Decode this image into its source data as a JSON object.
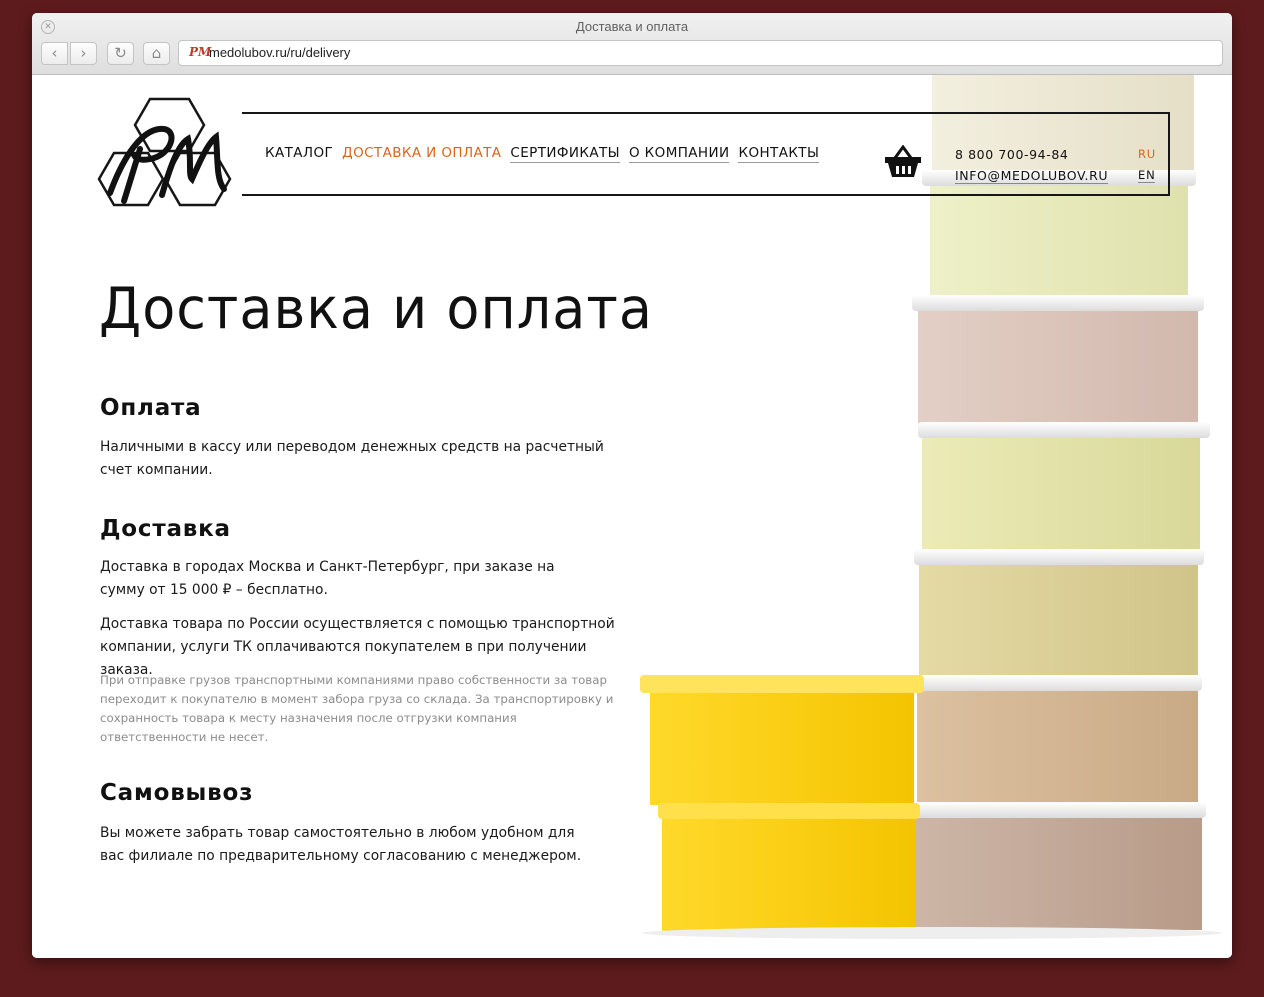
{
  "browser": {
    "window_title": "Доставка и оплата",
    "url": "medolubov.ru/ru/delivery",
    "favicon": "РМ"
  },
  "header": {
    "logo_text": "РМ",
    "menu": [
      {
        "label": "КАТАЛОГ"
      },
      {
        "label": "ДОСТАВКА И ОПЛАТА"
      },
      {
        "label": "СЕРТИФИКАТЫ"
      },
      {
        "label": "О КОМПАНИИ"
      },
      {
        "label": "КОНТАКТЫ"
      }
    ],
    "phone": "8 800 700-94-84",
    "email": "INFO@MEDOLUBOV.RU",
    "lang_ru": "RU",
    "lang_en": "EN"
  },
  "content": {
    "title": "Доставка и оплата",
    "payment": {
      "heading": "Оплата",
      "text": "Наличными в кассу или переводом денежных средств на расчетный счет компании."
    },
    "delivery": {
      "heading": "Доставка",
      "text1": "Доставка в городах Москва и Санкт-Петербург, при заказе на сумму от 15 000 ₽ – бесплатно.",
      "text2": "Доставка товара по России осуществляется с помощью транспортной компании, услуги ТК оплачиваются покупателем в при получении заказа.",
      "note": "При отправке грузов транспортными компаниями право собственности за товар переходит к покупателю в момент забора груза со склада. За транспортировку и сохранность товара к месту назначения после отгрузки компания ответственности не несет."
    },
    "pickup": {
      "heading": "Самовывоз",
      "text": "Вы можете забрать товар самостоятельно в любом удобном для вас филиале по предварительному согласованию с менеджером."
    }
  },
  "colors": {
    "accent": "#d8651e",
    "background": "#5e1b1d",
    "text": "#111111",
    "note": "#8c8c8c"
  }
}
